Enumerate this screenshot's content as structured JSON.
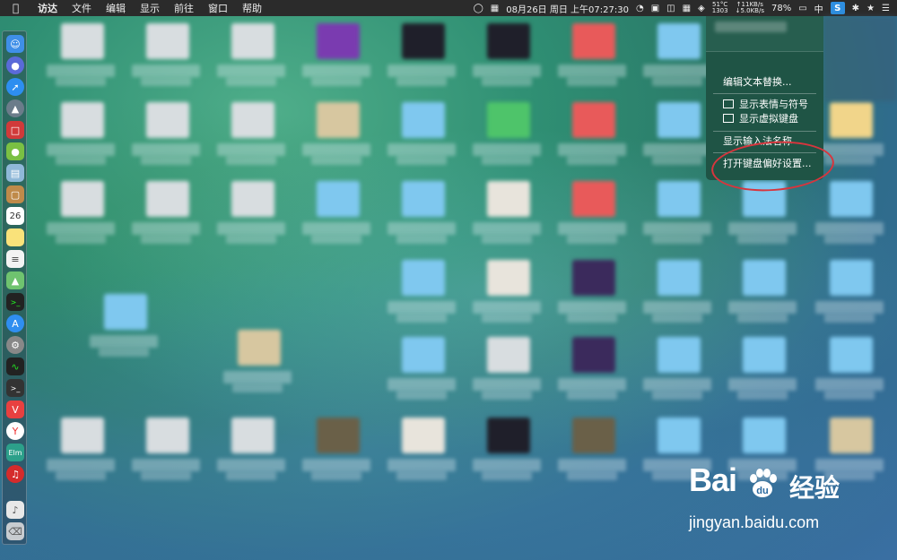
{
  "menubar": {
    "app_name": "访达",
    "items": [
      "文件",
      "编辑",
      "显示",
      "前往",
      "窗口",
      "帮助"
    ],
    "datetime": "08月26日 周日 上午07:27:30",
    "temp_top": "51°C",
    "temp_bottom": "1303",
    "net_up": "↑11KB/s",
    "net_down": "↓5.0KB/s",
    "battery": "78%",
    "input_lang": "中",
    "ime_icon_label": "S",
    "icons": [
      "apple-icon",
      "calendar-icon",
      "gauge-icon",
      "film-icon",
      "dashboard-icon",
      "windows-icon",
      "wifi-icon",
      "battery-icon",
      "ime-icon",
      "bluetooth-icon",
      "star-icon",
      "menu-icon"
    ]
  },
  "ime_menu": {
    "items": [
      {
        "label": "编辑文本替换..."
      },
      {
        "label": "显示表情与符号"
      },
      {
        "label": "显示虚拟键盘"
      },
      {
        "label": "显示输入法名称"
      },
      {
        "label": "打开键盘偏好设置..."
      }
    ]
  },
  "dock": {
    "icons": [
      "finder-icon",
      "siri-icon",
      "safari-icon",
      "launchpad-icon",
      "ime-icon",
      "android-icon",
      "preview-icon",
      "notes-icon",
      "calendar-icon",
      "stickies-icon",
      "reminders-icon",
      "maps-icon",
      "terminal-icon",
      "appstore-icon",
      "system-prefs-icon",
      "activity-monitor-icon",
      "terminal2-icon",
      "vivaldi-icon",
      "yandex-icon",
      "app-icon",
      "netease-music-icon",
      "music-icon",
      "trash-icon"
    ],
    "calendar_day": "26",
    "app_text": "Elm"
  },
  "watermark": {
    "logo": "Bai",
    "logo_suffix": "du",
    "cn": "经验",
    "url": "jingyan.baidu.com"
  }
}
